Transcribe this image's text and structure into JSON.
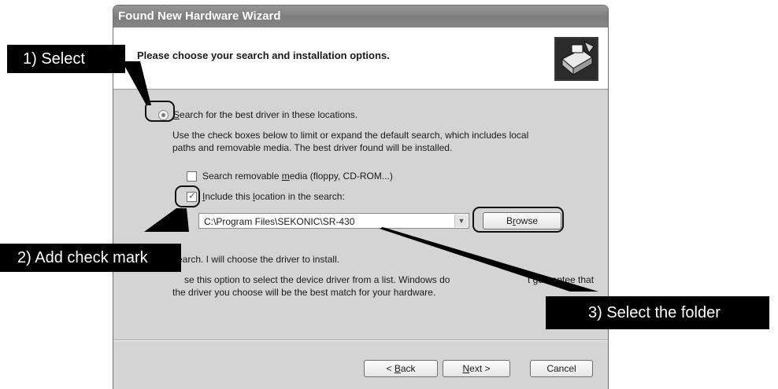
{
  "dialog": {
    "title": "Found New Hardware Wizard",
    "heading": "Please choose your search and installation options.",
    "search_option": {
      "label_first": "S",
      "label_rest": "earch for the best driver in these locations.",
      "description_line1": "Use the check boxes below to limit or expand the default search, which includes local",
      "description_line2": "paths and removable media. The best driver found will be installed."
    },
    "removable_media": {
      "label_pre": "Search removable ",
      "label_u": "m",
      "label_post": "edia (floppy, CD-ROM...)",
      "checked": false
    },
    "include_location": {
      "label_pre": "I",
      "label_mid": "nclude this ",
      "label_u": "l",
      "label_post": "ocation in the search:",
      "checked": true
    },
    "path_value": "C:\\Program Files\\SEKONIC\\SR-430",
    "browse_pre": "B",
    "browse_u": "r",
    "browse_post": "owse",
    "no_search_option": {
      "label": "search. I will choose the driver to install.",
      "description_line1_a": "se this option to select the device driver from a list.  Windows do",
      "description_line1_b": "t guarantee that",
      "description_line2": "the driver you choose will be the best match for your hardware."
    },
    "buttons": {
      "back_pre": "< ",
      "back_u": "B",
      "back_post": "ack",
      "next_u": "N",
      "next_post": "ext >",
      "cancel": "Cancel"
    }
  },
  "annotations": {
    "step1": "1) Select",
    "step2": "2) Add check mark",
    "step3": "3) Select the folder"
  }
}
